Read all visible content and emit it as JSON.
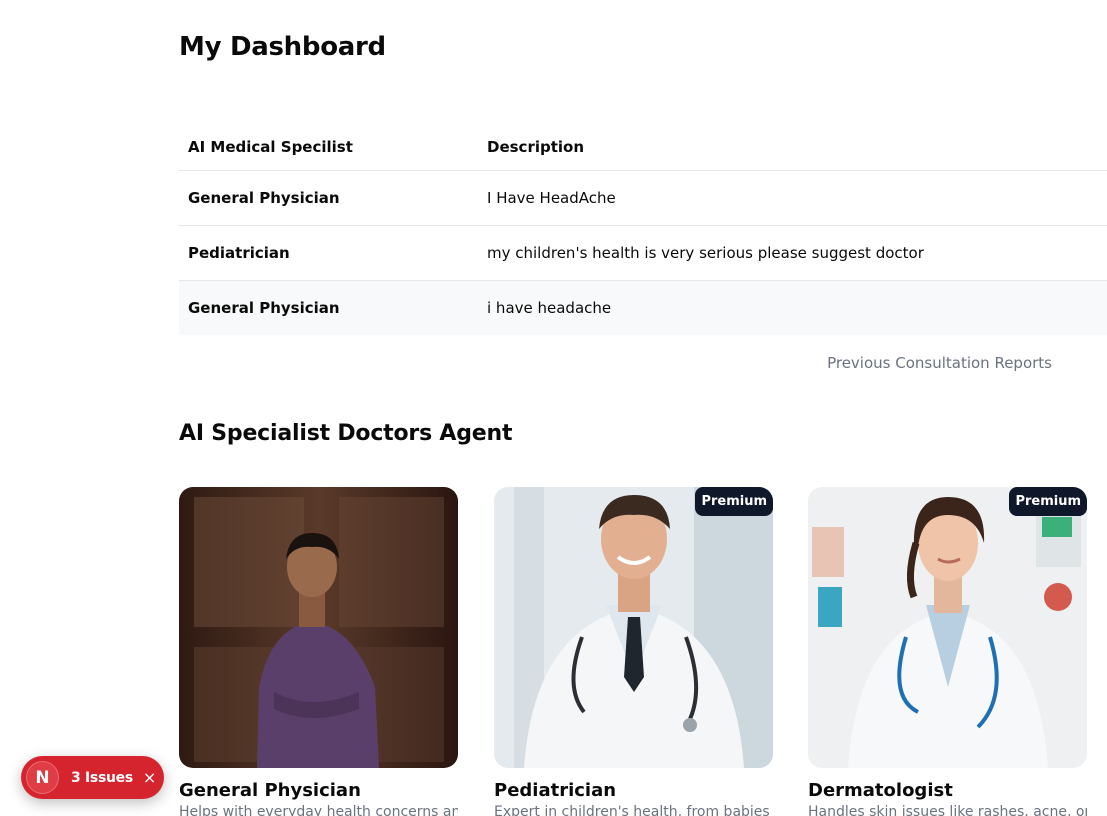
{
  "page": {
    "title": "My Dashboard"
  },
  "history": {
    "headers": [
      "AI Medical Specilist",
      "Description"
    ],
    "rows": [
      {
        "specialist": "General Physician",
        "description": "I Have HeadAche"
      },
      {
        "specialist": "Pediatrician",
        "description": "my children's health is very serious please suggest doctor"
      },
      {
        "specialist": "General Physician",
        "description": "i have headache"
      }
    ],
    "caption": "Previous Consultation Reports"
  },
  "agents": {
    "title": "AI Specialist Doctors Agent",
    "cards": [
      {
        "name": "General Physician",
        "description": "Helps with everyday health concerns and common symptoms.",
        "badge": ""
      },
      {
        "name": "Pediatrician",
        "description": "Expert in children's health, from babies to teens.",
        "badge": "Premium"
      },
      {
        "name": "Dermatologist",
        "description": "Handles skin issues like rashes, acne, or infections.",
        "badge": "Premium"
      }
    ]
  },
  "devtools": {
    "logo": "N",
    "issues_label": "3 Issues",
    "close_icon": "×"
  }
}
